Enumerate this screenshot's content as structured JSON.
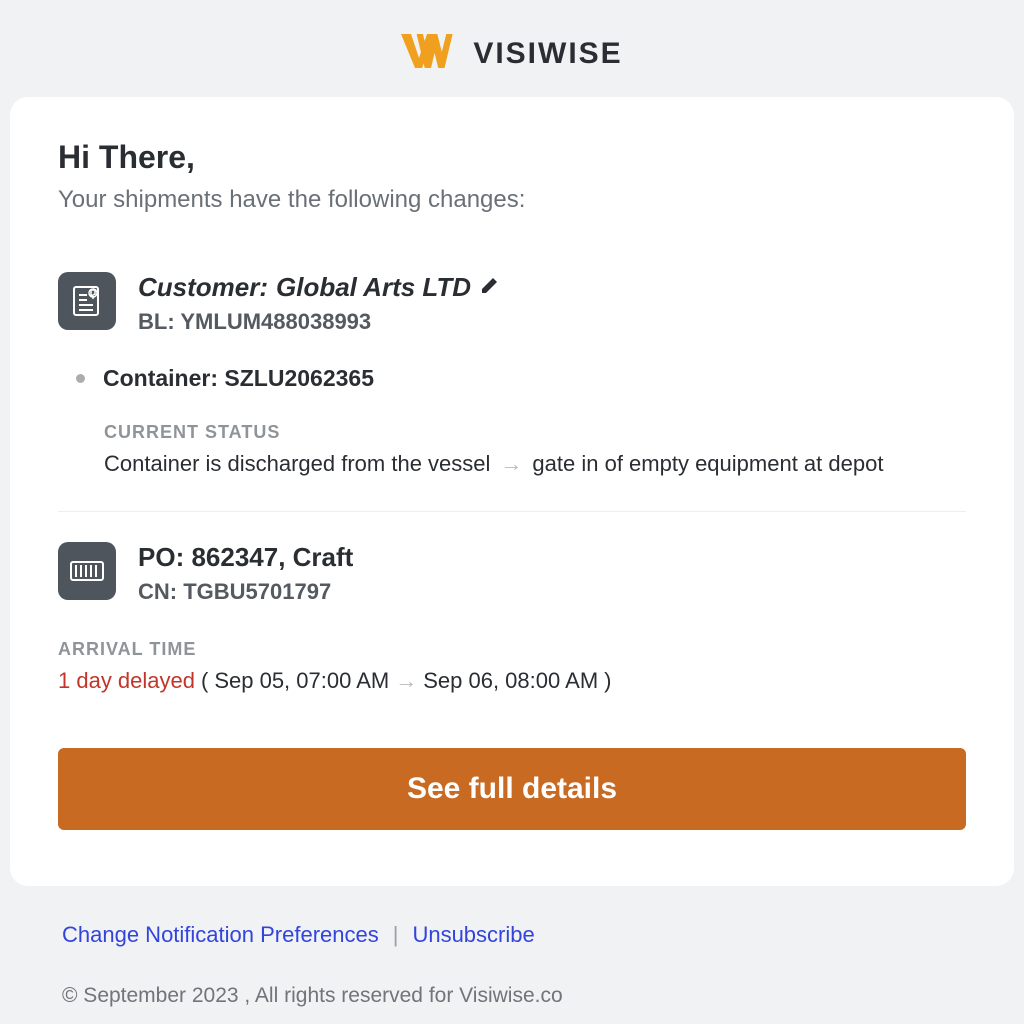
{
  "brand": {
    "name": "VISIWISE",
    "accent_color": "#f0a01e"
  },
  "greeting": "Hi There,",
  "intro_text": "Your shipments have the following changes:",
  "shipment1": {
    "title_prefix": "Customer: ",
    "customer_name": "Global Arts LTD",
    "bl_label": "BL: ",
    "bl_number": "YMLUM488038993",
    "container_label": "Container: ",
    "container_number": "SZLU2062365",
    "status_section_label": "CURRENT STATUS",
    "status_from": "Container is discharged from the vessel",
    "status_to": "gate in of empty equipment at depot"
  },
  "shipment2": {
    "po_label": "PO: ",
    "po_value": "862347, Craft",
    "cn_label": "CN: ",
    "cn_number": "TGBU5701797",
    "arrival_section_label": "ARRIVAL TIME",
    "delay_text": "1 day delayed",
    "arrival_open": "(",
    "arrival_from": "Sep 05, 07:00 AM",
    "arrival_to": "Sep 06, 08:00 AM",
    "arrival_close": ")"
  },
  "cta_label": "See full details",
  "footer": {
    "link_prefs": "Change Notification Preferences",
    "sep": "|",
    "link_unsub": "Unsubscribe",
    "copyright": "© September 2023 , All rights reserved for Visiwise.co"
  }
}
